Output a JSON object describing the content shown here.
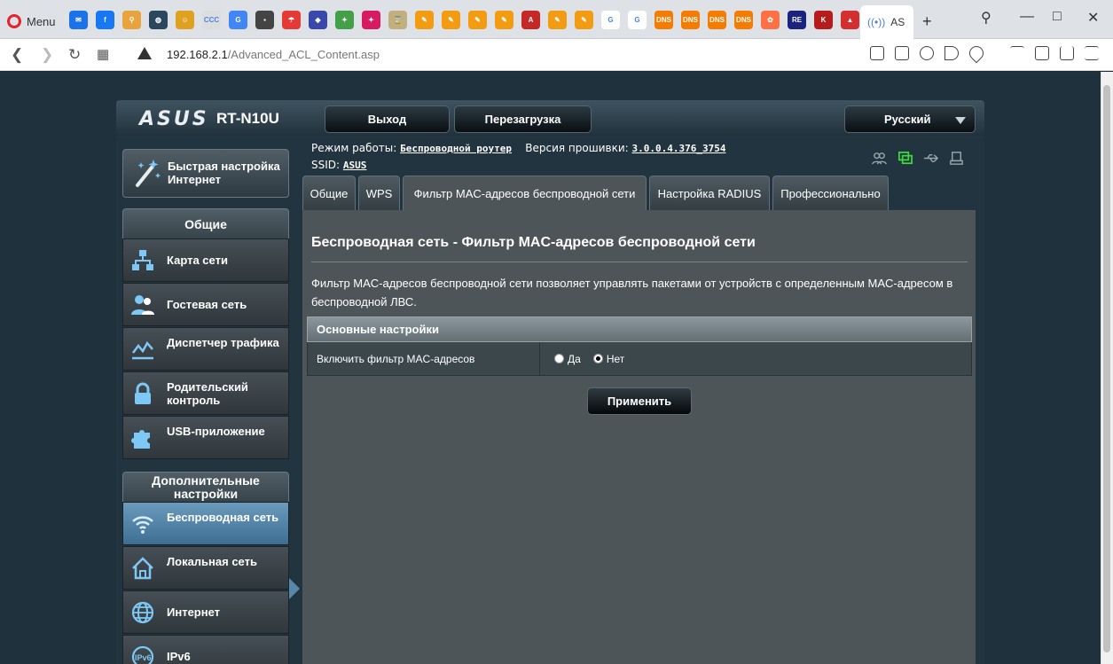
{
  "browser": {
    "menu_label": "Menu",
    "active_tab_label": "AS",
    "url_host": "192.168.2.1",
    "url_path": "/Advanced_ACL_Content.asp",
    "tab_icons": [
      {
        "name": "mail-icon",
        "color": "#1a73e8",
        "glyph": "✉"
      },
      {
        "name": "facebook-icon",
        "color": "#1877f2",
        "glyph": "f"
      },
      {
        "name": "maps-icon",
        "color": "#e8a33d",
        "glyph": "⚲"
      },
      {
        "name": "steam-icon",
        "color": "#2a475e",
        "glyph": "◍"
      },
      {
        "name": "cat-icon",
        "color": "#e0a020",
        "glyph": "☺"
      },
      {
        "name": "ccc-icon",
        "color": "#dddddd",
        "glyph": "CCC"
      },
      {
        "name": "translate-icon",
        "color": "#4285f4",
        "glyph": "G"
      },
      {
        "name": "terminal-icon",
        "color": "#444444",
        "glyph": "▪"
      },
      {
        "name": "umbrella-icon",
        "color": "#e53935",
        "glyph": "☂"
      },
      {
        "name": "diamond-icon",
        "color": "#3949ab",
        "glyph": "◆"
      },
      {
        "name": "star-icon",
        "color": "#43a047",
        "glyph": "✦"
      },
      {
        "name": "star2-icon",
        "color": "#d81b60",
        "glyph": "✦"
      },
      {
        "name": "hourglass-icon",
        "color": "#c0b080",
        "glyph": "⌛"
      },
      {
        "name": "plugin-icon",
        "color": "#f39c12",
        "glyph": "✎"
      },
      {
        "name": "plugin-icon",
        "color": "#f39c12",
        "glyph": "✎"
      },
      {
        "name": "plugin-icon",
        "color": "#f39c12",
        "glyph": "✎"
      },
      {
        "name": "plugin-icon",
        "color": "#f39c12",
        "glyph": "✎"
      },
      {
        "name": "angular-icon",
        "color": "#c62828",
        "glyph": "A"
      },
      {
        "name": "plugin-icon",
        "color": "#f39c12",
        "glyph": "✎"
      },
      {
        "name": "plugin-icon",
        "color": "#f39c12",
        "glyph": "✎"
      },
      {
        "name": "google-icon",
        "color": "#ffffff",
        "glyph": "G"
      },
      {
        "name": "google-icon",
        "color": "#ffffff",
        "glyph": "G"
      },
      {
        "name": "dns-icon",
        "color": "#f57c00",
        "glyph": "DNS"
      },
      {
        "name": "dns-icon",
        "color": "#f57c00",
        "glyph": "DNS"
      },
      {
        "name": "dns-icon",
        "color": "#f57c00",
        "glyph": "DNS"
      },
      {
        "name": "dns-icon",
        "color": "#f57c00",
        "glyph": "DNS"
      },
      {
        "name": "flower-icon",
        "color": "#ff7043",
        "glyph": "✿"
      },
      {
        "name": "re-icon",
        "color": "#1a237e",
        "glyph": "RE"
      },
      {
        "name": "k-icon",
        "color": "#b71c1c",
        "glyph": "K"
      },
      {
        "name": "acrobat-icon",
        "color": "#d32f2f",
        "glyph": "▲"
      }
    ]
  },
  "header": {
    "logo": "ASUS",
    "model": "RT-N10U",
    "logout_label": "Выход",
    "reboot_label": "Перезагрузка",
    "language": "Русский"
  },
  "status": {
    "mode_label": "Режим работы:",
    "mode_value": "Беспроводной роутер",
    "fw_label": "Версия прошивки:",
    "fw_value": "3.0.0.4.376_3754",
    "ssid_label": "SSID:",
    "ssid_value": "ASUS"
  },
  "sidebar": {
    "quick_setup": "Быстрая настройка Интернет",
    "general_header": "Общие",
    "general_items": [
      {
        "label": "Карта сети",
        "icon": "network-map-icon"
      },
      {
        "label": "Гостевая сеть",
        "icon": "guest-network-icon"
      },
      {
        "label": "Диспетчер трафика",
        "icon": "traffic-manager-icon"
      },
      {
        "label": "Родительский контроль",
        "icon": "parental-control-icon"
      },
      {
        "label": "USB-приложение",
        "icon": "usb-app-icon"
      }
    ],
    "advanced_header": "Дополнительные настройки",
    "advanced_items": [
      {
        "label": "Беспроводная сеть",
        "icon": "wireless-icon",
        "active": true
      },
      {
        "label": "Локальная сеть",
        "icon": "lan-icon"
      },
      {
        "label": "Интернет",
        "icon": "wan-icon"
      },
      {
        "label": "IPv6",
        "icon": "ipv6-icon"
      }
    ]
  },
  "tabs": [
    {
      "label": "Общие"
    },
    {
      "label": "WPS"
    },
    {
      "label": "Фильтр MAC-адресов беспроводной сети",
      "active": true
    },
    {
      "label": "Настройка RADIUS"
    },
    {
      "label": "Профессионально"
    }
  ],
  "content": {
    "title": "Беспроводная сеть - Фильтр MAC-адресов беспроводной сети",
    "description": "Фильтр MAC-адресов беспроводной сети позволяет управлять пакетами от устройств с определенным MAC-адресом в беспроводной ЛВС.",
    "section_header": "Основные настройки",
    "mac_filter_label": "Включить фильтр MAC-адресов",
    "option_yes": "Да",
    "option_no": "Нет",
    "selected": "Нет",
    "apply_label": "Применить"
  }
}
